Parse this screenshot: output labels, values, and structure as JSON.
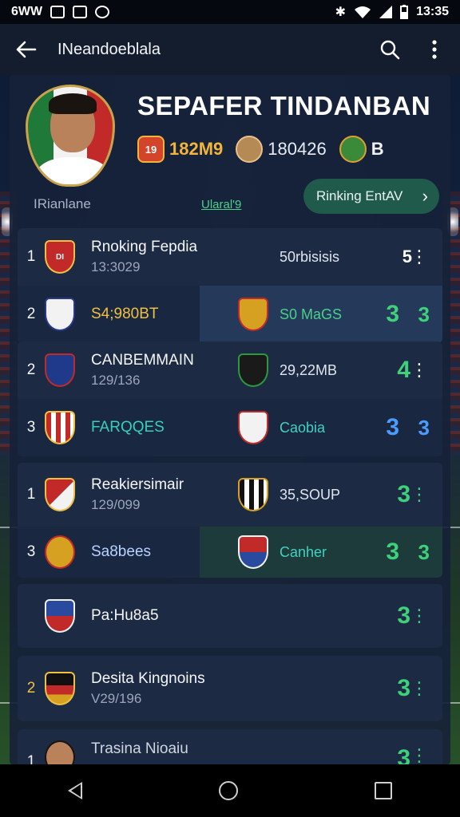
{
  "status_bar": {
    "left_text": "6WW",
    "time": "13:35"
  },
  "app_bar": {
    "title": "INeandoeblala"
  },
  "hero": {
    "title": "SEPAFER TINDANBAN",
    "stats": [
      {
        "badge": "19",
        "value": "182M9"
      },
      {
        "badge": "",
        "value": "180426"
      },
      {
        "badge": "",
        "value": "B"
      }
    ],
    "subtitle": "IRianlane",
    "green_link": "Ularal'9",
    "ranking_button": "Rinking EntAV"
  },
  "cards": [
    {
      "rows": [
        {
          "num": "1",
          "name": "Rnoking Fepdia",
          "sub": "13:3029",
          "right_value": "50rbisisis",
          "score": "5"
        },
        {
          "num": "2",
          "name": "S4;980BT",
          "right_value": "S0 MaGS",
          "score": "3",
          "score2": "3"
        }
      ]
    },
    {
      "rows": [
        {
          "num": "2",
          "name": "CANBEMMAIN",
          "sub": "129/136",
          "right_value": "29,22MB",
          "score": "4"
        },
        {
          "num": "3",
          "name": "FARQQES",
          "right_value": "Caobia",
          "score": "3",
          "score2": "3"
        }
      ]
    },
    {
      "rows": [
        {
          "num": "1",
          "name": "Reakiersimair",
          "sub": "129/099",
          "right_value": "35,SOUP",
          "score": "3"
        },
        {
          "num": "3",
          "name": "Sa8bees",
          "right_value": "Canher",
          "score": "3",
          "score2": "3"
        }
      ]
    },
    {
      "rows": [
        {
          "name": "Pa:Hu8a5",
          "score": "3"
        }
      ]
    },
    {
      "rows": [
        {
          "num": "2",
          "name": "Desita Kingnoins",
          "sub": "V29/196",
          "score": "3"
        }
      ]
    },
    {
      "rows": [
        {
          "num": "1",
          "name": "Trasina Nioaiu",
          "score": "3"
        }
      ]
    }
  ]
}
